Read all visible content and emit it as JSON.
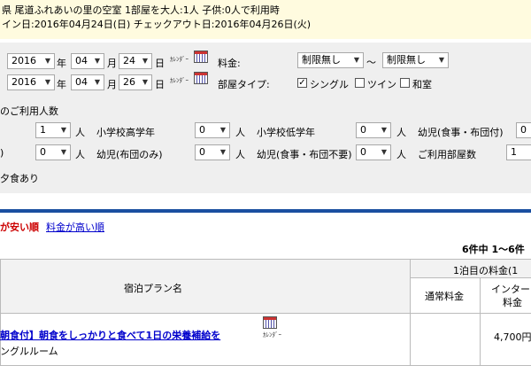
{
  "summary": {
    "line1": "県 尾道ふれあいの里の空室 1部屋を大人:1人 子供:0人で利用時",
    "line2": "イン日:2016年04月24日(日) チェックアウト日:2016年04月26日(火)"
  },
  "search": {
    "checkin": {
      "year": "2016",
      "month": "04",
      "day": "24"
    },
    "checkout": {
      "year": "2016",
      "month": "04",
      "day": "26"
    },
    "year_unit": "年",
    "month_unit": "月",
    "day_unit": "日",
    "calendar_label": "ｶﾚﾝﾀﾞｰ",
    "price_label": "料金:",
    "price_min": "制限無し",
    "tilde": "～",
    "price_max": "制限無し",
    "room_type_label": "部屋タイプ:",
    "room_types": [
      {
        "label": "シングル",
        "checked": true
      },
      {
        "label": "ツイン",
        "checked": false
      },
      {
        "label": "和室",
        "checked": false
      }
    ],
    "guests_heading": "のご利用人数",
    "person_unit": "人",
    "row1": {
      "adult_value": "1",
      "elem_upper_label": "小学校高学年",
      "elem_upper_value": "0",
      "elem_lower_label": "小学校低学年",
      "elem_lower_value": "0",
      "infant_meal_bed_label": "幼児(食事・布団付)",
      "infant_meal_bed_value": "0"
    },
    "row2": {
      "left_fragment": ")",
      "first_value": "0",
      "infant_bed_label": "幼児(布団のみ)",
      "infant_bed_value": "0",
      "infant_none_label": "幼児(食事・布団不要)",
      "infant_none_value": "0",
      "rooms_label": "ご利用部屋数",
      "rooms_value": "1"
    },
    "meal_text": "夕食あり"
  },
  "sort": {
    "cheap_order": "が安い順",
    "expensive_order": "料金が高い順"
  },
  "results": {
    "count_text": "6件中 1～6件",
    "col_plan": "宿泊プラン名",
    "col_first_night": "1泊目の料金(1",
    "col_regular": "通常料金",
    "col_internet": "インター",
    "col_internet2": "料金"
  },
  "plans": [
    {
      "title": "朝食付】朝食をしっかりと食べて1日の栄養補給を",
      "calendar": "ｶﾚﾝﾀﾞｰ",
      "room": "ングルルーム",
      "regular_price": "",
      "internet_price": "4,700円"
    }
  ],
  "colors": {
    "summary_bg": "#fffbdf",
    "panel_bg": "#efefef",
    "divider": "#1a4fa0",
    "link": "#0000cc",
    "accent_red": "#cc0000"
  }
}
